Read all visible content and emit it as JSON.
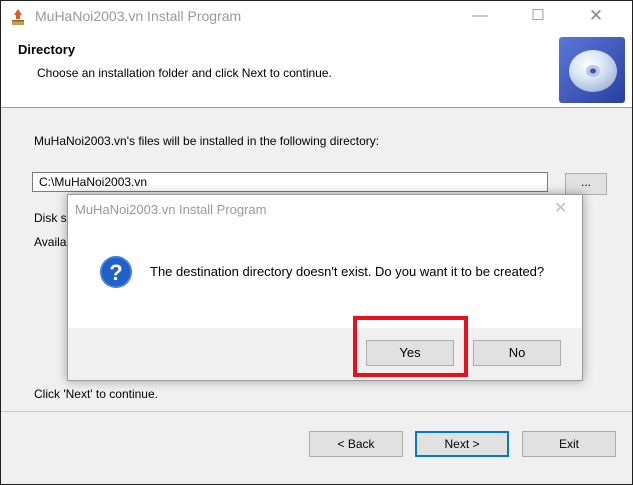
{
  "window": {
    "title": "MuHaNoi2003.vn Install Program",
    "minimize_glyph": "—",
    "maximize_glyph": "☐",
    "close_glyph": "✕"
  },
  "header": {
    "title": "Directory",
    "subtitle": "Choose an installation folder and click Next to continue.",
    "icon": "cd-disc-icon"
  },
  "body": {
    "intro": "MuHaNoi2003.vn's files will be installed in the following directory:",
    "directory_value": "C:\\MuHaNoi2003.vn",
    "browse_label": "...",
    "disk_space_label": "Disk s",
    "available_label": "Availa",
    "continue_text": "Click 'Next' to continue."
  },
  "footer": {
    "back_label": "< Back",
    "next_label": "Next >",
    "exit_label": "Exit"
  },
  "dialog": {
    "title": "MuHaNoi2003.vn Install Program",
    "close_glyph": "✕",
    "icon": "question-icon",
    "message": "The destination directory doesn't exist. Do you want it to be created?",
    "yes_label": "Yes",
    "no_label": "No"
  },
  "colors": {
    "highlight": "#e8101c",
    "question_icon": "#1e62c8",
    "focus_border": "#0078d7"
  }
}
